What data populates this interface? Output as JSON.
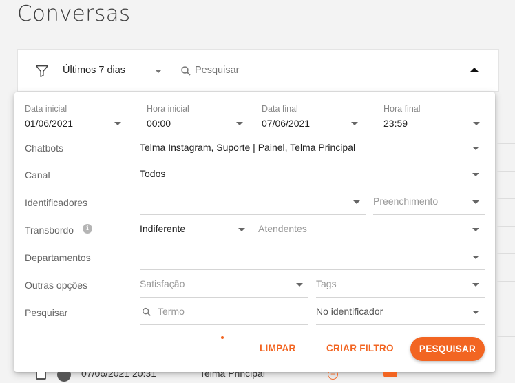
{
  "page": {
    "title": "Conversas"
  },
  "filter_bar": {
    "period": "Últimos 7 dias",
    "search_placeholder": "Pesquisar"
  },
  "panel": {
    "date_start": {
      "label": "Data inicial",
      "value": "01/06/2021"
    },
    "time_start": {
      "label": "Hora inicial",
      "value": "00:00"
    },
    "date_end": {
      "label": "Data final",
      "value": "07/06/2021"
    },
    "time_end": {
      "label": "Hora final",
      "value": "23:59"
    },
    "chatbots": {
      "label": "Chatbots",
      "value": "Telma Instagram, Suporte | Painel, Telma Principal"
    },
    "canal": {
      "label": "Canal",
      "value": "Todos"
    },
    "identificadores": {
      "label": "Identificadores",
      "value": "",
      "preenchimento_placeholder": "Preenchimento"
    },
    "transbordo": {
      "label": "Transbordo",
      "value": "Indiferente",
      "atendentes_placeholder": "Atendentes"
    },
    "departamentos": {
      "label": "Departamentos",
      "value": ""
    },
    "outras_opcoes": {
      "label": "Outras opções",
      "satisfacao_placeholder": "Satisfação",
      "tags_placeholder": "Tags"
    },
    "pesquisar": {
      "label": "Pesquisar",
      "termo_placeholder": "Termo",
      "scope": "No identificador"
    }
  },
  "actions": {
    "clear": "LIMPAR",
    "create_filter": "CRIAR FILTRO",
    "search": "PESQUISAR"
  },
  "background_row": {
    "date": "07/06/2021 20:31",
    "chatbot": "Telma Principal",
    "plus_symbol": "+"
  },
  "colors": {
    "accent": "#f26522"
  }
}
